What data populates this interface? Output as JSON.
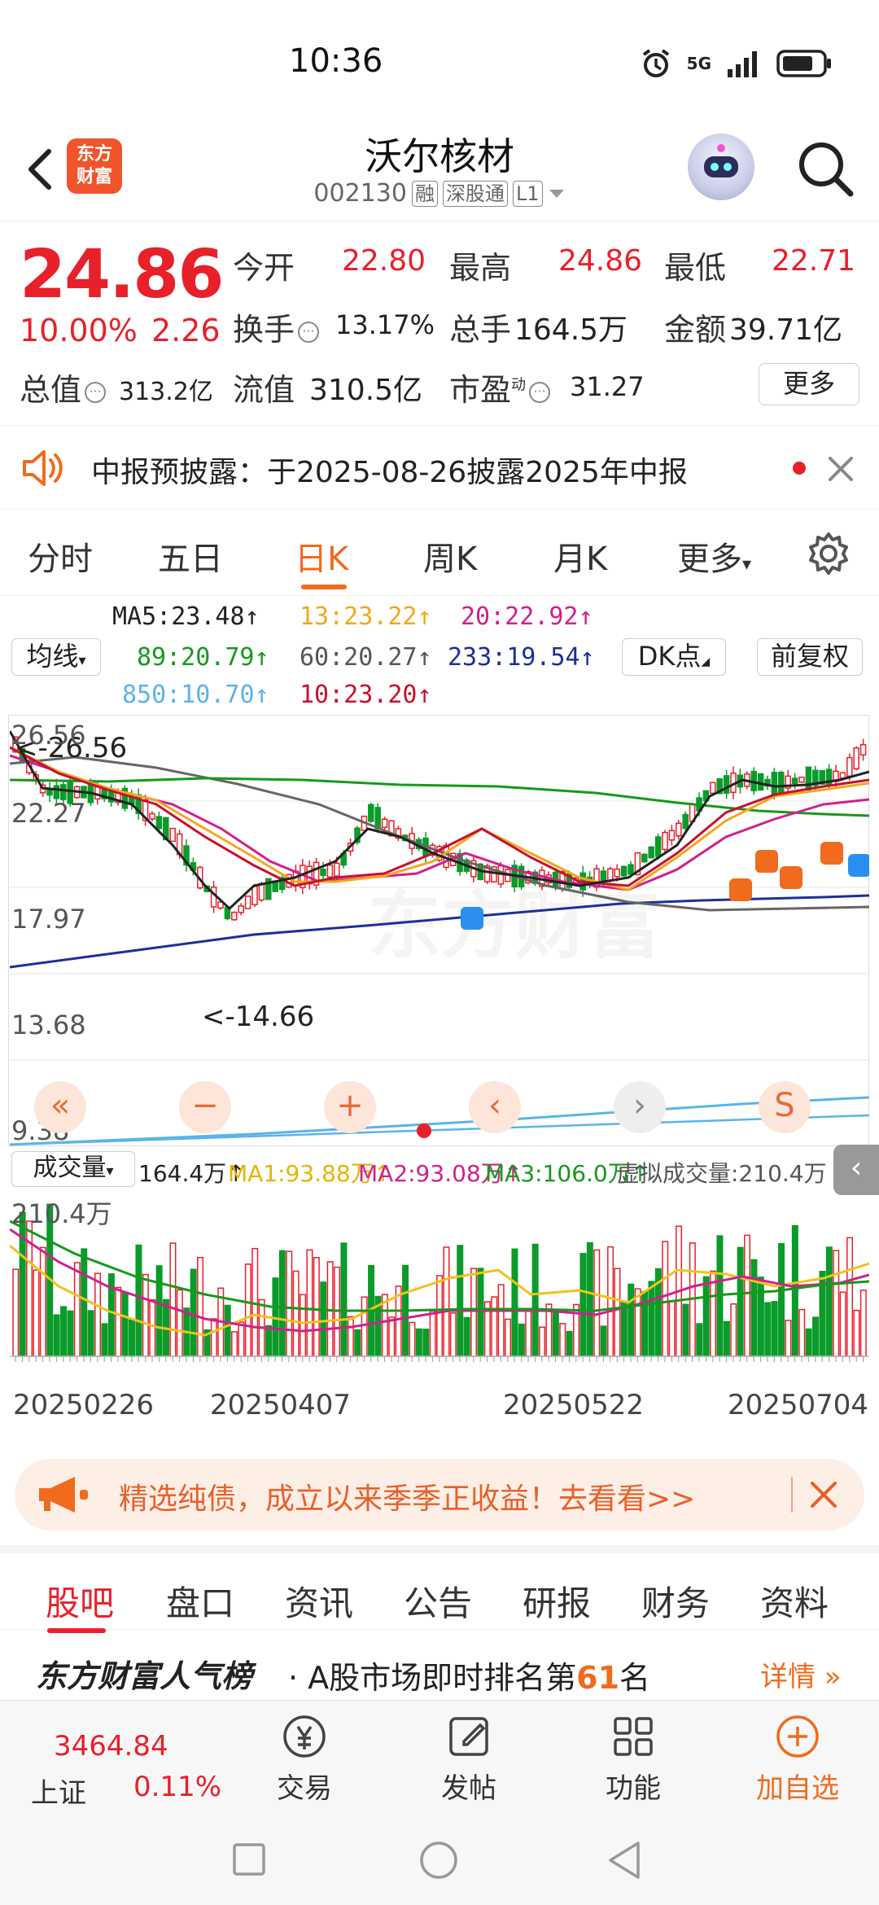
{
  "status_bar": {
    "time": "10:36",
    "network": "5G",
    "network_sub": "1l"
  },
  "header": {
    "logo_line1": "东方",
    "logo_line2": "财富",
    "stock_name": "沃尔核材",
    "stock_code": "002130",
    "tags": [
      "融",
      "深股通",
      "L1"
    ]
  },
  "quote": {
    "price": "24.86",
    "change_pct": "10.00%",
    "change": "2.26",
    "open_label": "今开",
    "open": "22.80",
    "high_label": "最高",
    "high": "24.86",
    "low_label": "最低",
    "low": "22.71",
    "turnover_label": "换手",
    "turnover": "13.17%",
    "volume_label": "总手",
    "volume": "164.5万",
    "amount_label": "金额",
    "amount": "39.71亿",
    "mcap_label": "总值",
    "mcap": "313.2亿",
    "float_label": "流值",
    "float_val": "310.5亿",
    "pe_label": "市盈",
    "pe_sup": "动",
    "pe": "31.27",
    "more_label": "更多"
  },
  "notice": {
    "text": "中报预披露：于2025-08-26披露2025年中报"
  },
  "chart_tabs": [
    "分时",
    "五日",
    "日K",
    "周K",
    "月K",
    "更多"
  ],
  "ma_legend": {
    "ma_button": "均线",
    "ma5": "MA5:23.48↑",
    "ma13": "13:23.22↑",
    "ma20": "20:22.92↑",
    "ma89": "89:20.79↑",
    "ma60": "60:20.27↑",
    "ma233": "233:19.54↑",
    "ma850": "850:10.70↑",
    "ma10": "10:23.20↑",
    "dk_button": "DK点",
    "fq_button": "前复权",
    "colors": {
      "ma5": "#222222",
      "ma13": "#f2a81d",
      "ma20": "#d0208e",
      "ma89": "#159a1a",
      "ma60": "#666666",
      "ma233": "#1c2f9a",
      "ma850": "#5ab4e8",
      "ma10": "#c8102e"
    }
  },
  "chart": {
    "y_labels": [
      "26.56",
      "22.27",
      "17.97",
      "13.68",
      "9.38"
    ],
    "max_label": "<-26.56",
    "min_label": "<-14.66",
    "watermark": "东方财富"
  },
  "volume": {
    "selector": "成交量",
    "value": "164.4万↑",
    "ma1": "MA1:93.88万↑",
    "ma2": "MA2:93.08万↑",
    "ma3": "MA3:106.0万↑",
    "virtual": "虚拟成交量:210.4万",
    "max_label": "210.4万"
  },
  "dates": [
    "20250226",
    "20250407",
    "20250522",
    "20250704"
  ],
  "ad": {
    "text": "精选纯债，成立以来季季正收益！去看看>>"
  },
  "info_tabs": [
    "股吧",
    "盘口",
    "资讯",
    "公告",
    "研报",
    "财务",
    "资料"
  ],
  "rank": {
    "brand": "东方财富人气榜",
    "prefix": "· A股市场即时排名第",
    "number": "61",
    "suffix": "名",
    "detail": "详情"
  },
  "index": {
    "value": "3464.84",
    "name": "上证",
    "pct": "0.11%"
  },
  "bottom_nav": [
    "交易",
    "发帖",
    "功能",
    "加自选"
  ]
}
